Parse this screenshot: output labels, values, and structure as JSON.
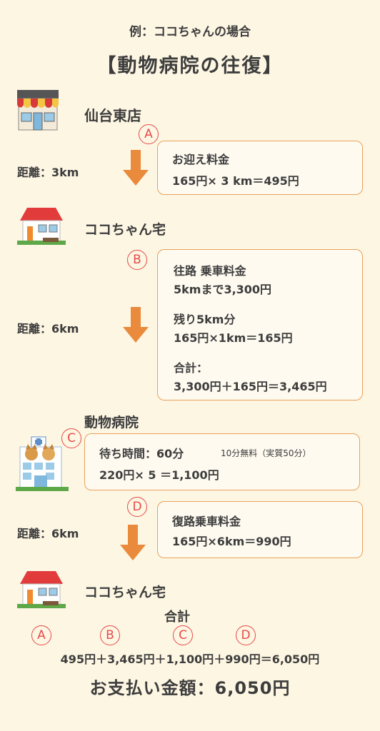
{
  "header": {
    "example": "例：ココちゃんの場合",
    "title": "【動物病院の往復】"
  },
  "colors": {
    "background": "#fdf6e3",
    "box_border": "#e9a25a",
    "arrow": "#e98a3c",
    "circle": "#e64a4a"
  },
  "stops": {
    "shop": "仙台東店",
    "home1": "ココちゃん宅",
    "hospital": "動物病院",
    "home2": "ココちゃん宅"
  },
  "distances": {
    "d1": "距離：3km",
    "d2": "距離：6km",
    "d3": "距離：6km"
  },
  "markers": {
    "a": "A",
    "b": "B",
    "c": "C",
    "d": "D"
  },
  "box_a": {
    "label": "お迎え料金",
    "calc": "165円× 3 km＝495円"
  },
  "box_b": {
    "label": "往路 乗車料金",
    "base": "5kmまで3,300円",
    "rest_label": "残り5km分",
    "rest_calc": "165円×1km＝165円",
    "sum_label": "合計：",
    "sum_calc": "3,300円＋165円＝3,465円"
  },
  "box_c": {
    "label": "待ち時間：60分",
    "note": "10分無料（実質50分）",
    "calc": "220円× 5 ＝1,100円"
  },
  "box_d": {
    "label": "復路乗車料金",
    "calc": "165円×6km＝990円"
  },
  "total": {
    "label": "合計",
    "formula": "495円＋3,465円＋1,100円＋990円＝6,050円",
    "payment": "お支払い金額：6,050円"
  }
}
